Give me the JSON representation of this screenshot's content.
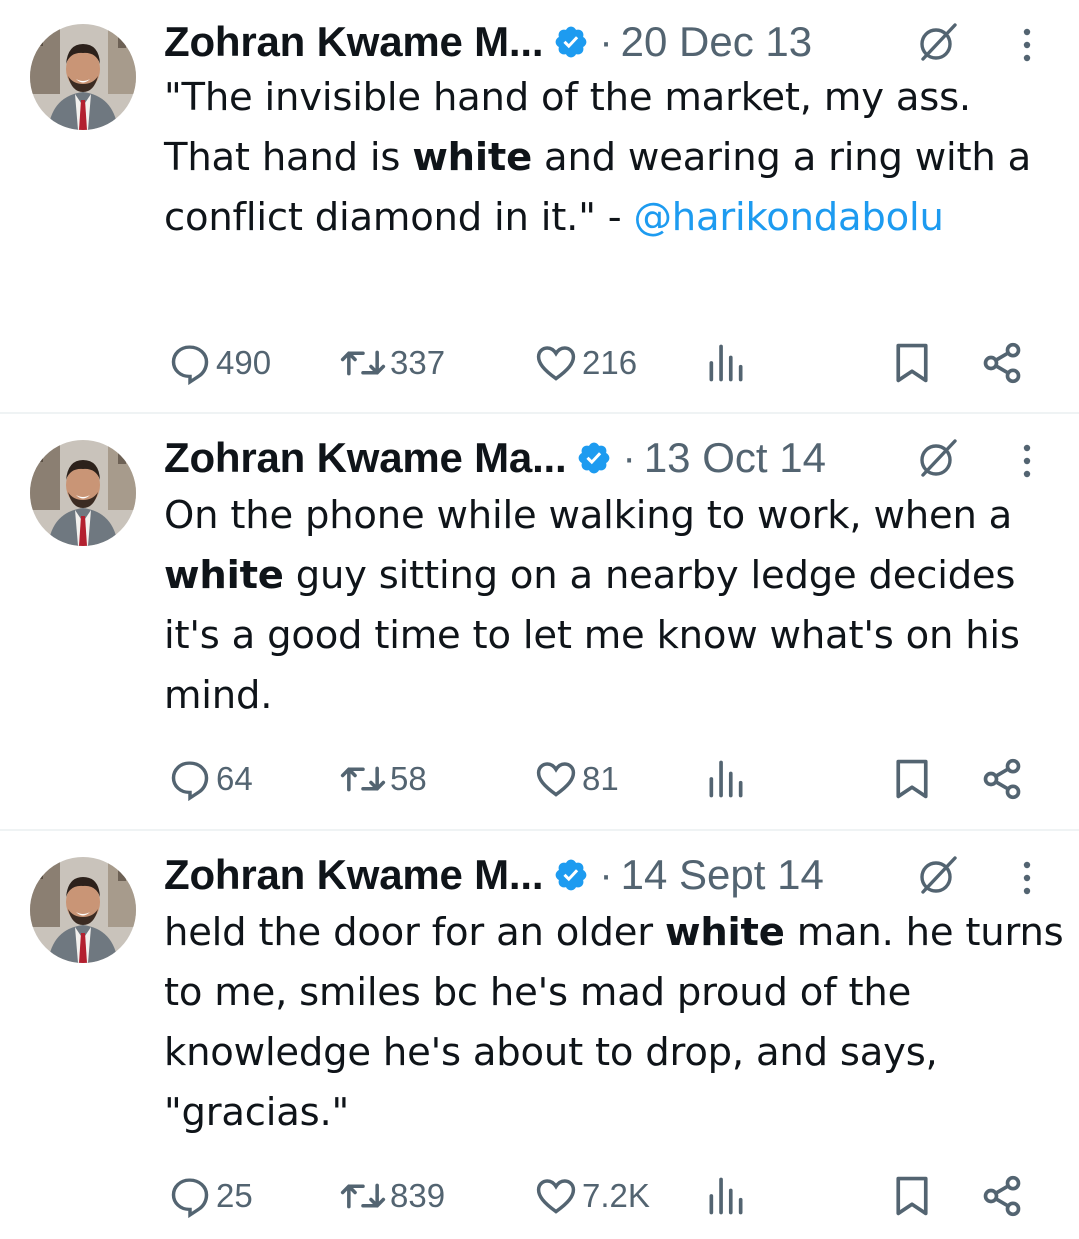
{
  "tweets": [
    {
      "author": "Zohran Kwame M...",
      "date": "20 Dec 13",
      "text_parts": [
        {
          "t": "\"The invisible hand of the market, my ass. That hand is "
        },
        {
          "t": "white",
          "bold": true
        },
        {
          "t": " and wearing a ring with a conflict diamond in it.\" - "
        },
        {
          "t": "@harikondabolu",
          "mention": true
        }
      ],
      "replies": "490",
      "reposts": "337",
      "likes": "216"
    },
    {
      "author": "Zohran Kwame Ma...",
      "date": "13 Oct 14",
      "text_parts": [
        {
          "t": "On the phone while walking to work, when a "
        },
        {
          "t": "white",
          "bold": true
        },
        {
          "t": " guy sitting on a nearby ledge decides it's a good time to let me know what's on his mind."
        }
      ],
      "replies": "64",
      "reposts": "58",
      "likes": "81"
    },
    {
      "author": "Zohran Kwame M...",
      "date": "14 Sept 14",
      "text_parts": [
        {
          "t": "held the door for an older "
        },
        {
          "t": "white",
          "bold": true
        },
        {
          "t": " man. he turns to me, smiles bc he's mad proud of the knowledge he's about to drop, and says, \"gracias.\""
        }
      ],
      "replies": "25",
      "reposts": "839",
      "likes": "7.2K"
    }
  ],
  "header_separator": "·",
  "colors": {
    "text": "#0f1419",
    "secondary": "#536471",
    "link": "#1d9bf0",
    "verified": "#1d9bf0",
    "divider": "#eff3f4"
  },
  "icons": [
    "verified-badge-icon",
    "grok-icon",
    "more-icon",
    "reply-icon",
    "repost-icon",
    "like-icon",
    "views-icon",
    "bookmark-icon",
    "share-icon"
  ]
}
